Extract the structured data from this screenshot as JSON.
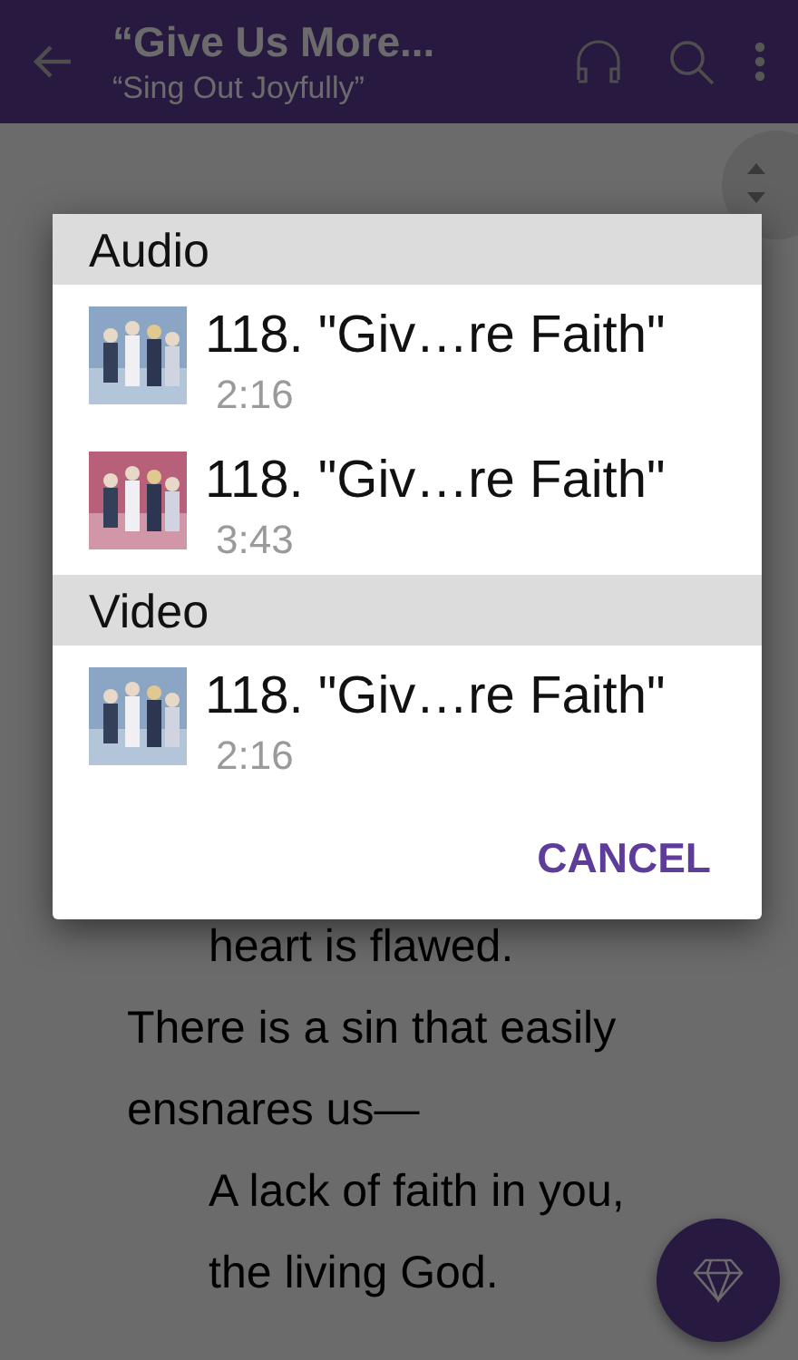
{
  "app_bar": {
    "title": "“Give Us More...",
    "subtitle": "“Sing Out Joyfully”"
  },
  "page": {
    "lyrics": [
      {
        "text": "heart is flawed.",
        "kind": "indented"
      },
      {
        "text": "There is a sin that easily ensnares us—",
        "kind": "plain"
      },
      {
        "text": "A lack of faith in you, the living God.",
        "kind": "indented"
      }
    ]
  },
  "dialog": {
    "sections": [
      {
        "title": "Audio",
        "items": [
          {
            "title": "118. \"Giv…re Faith\"",
            "duration": "2:16",
            "color": "#8aa6c4"
          },
          {
            "title": "118. \"Giv…re Faith\"",
            "duration": "3:43",
            "color": "#b8607a"
          }
        ]
      },
      {
        "title": "Video",
        "items": [
          {
            "title": "118. \"Giv…re Faith\"",
            "duration": "2:16",
            "color": "#8aa6c4"
          }
        ]
      }
    ],
    "cancel": "CANCEL"
  }
}
